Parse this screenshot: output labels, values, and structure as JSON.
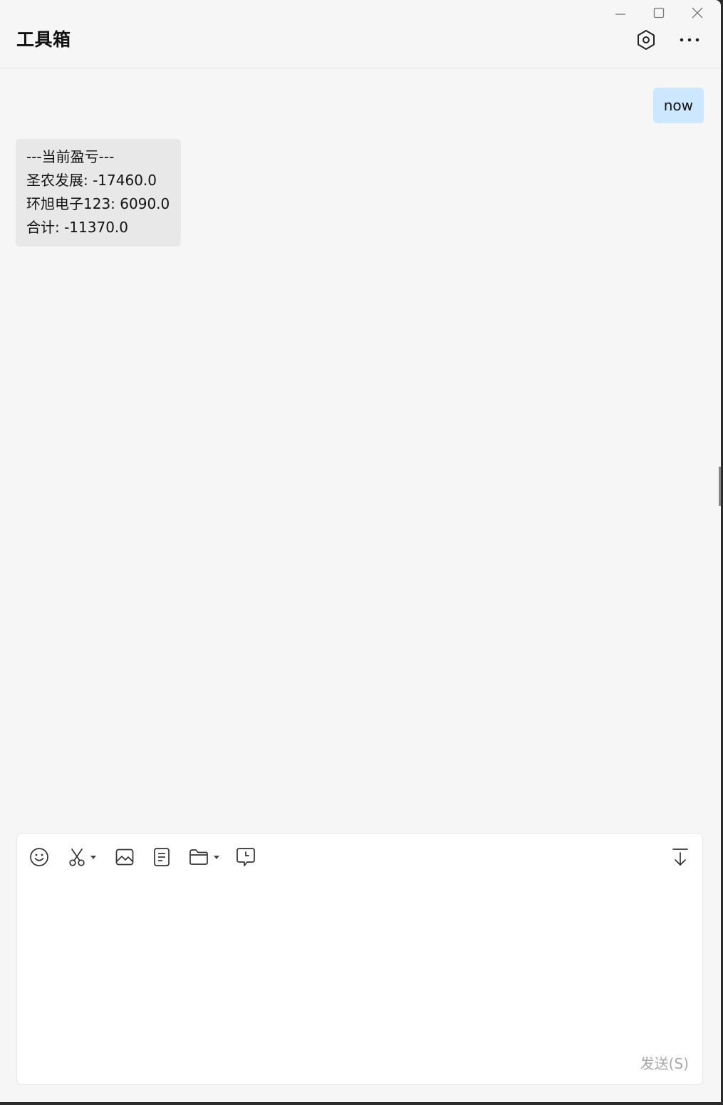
{
  "header": {
    "title": "工具箱"
  },
  "window_controls": {
    "minimize_icon": "minimize-icon",
    "maximize_icon": "maximize-icon",
    "close_icon": "close-icon"
  },
  "messages": {
    "outgoing": [
      {
        "text": "now"
      }
    ],
    "incoming": [
      {
        "lines": [
          "---当前盈亏---",
          "圣农发展: -17460.0",
          "环旭电子123: 6090.0",
          "合计: -11370.0"
        ]
      }
    ]
  },
  "composer": {
    "send_label": "发送(S)",
    "input_value": "",
    "tools": [
      "emoji-icon",
      "scissors-icon",
      "image-icon",
      "document-icon",
      "folder-icon",
      "chat-history-icon",
      "download-icon"
    ]
  },
  "colors": {
    "background": "#f6f6f6",
    "outgoing_bubble": "#cde7fe",
    "incoming_bubble": "#e8e8e8",
    "send_disabled": "#a8a8a8"
  }
}
